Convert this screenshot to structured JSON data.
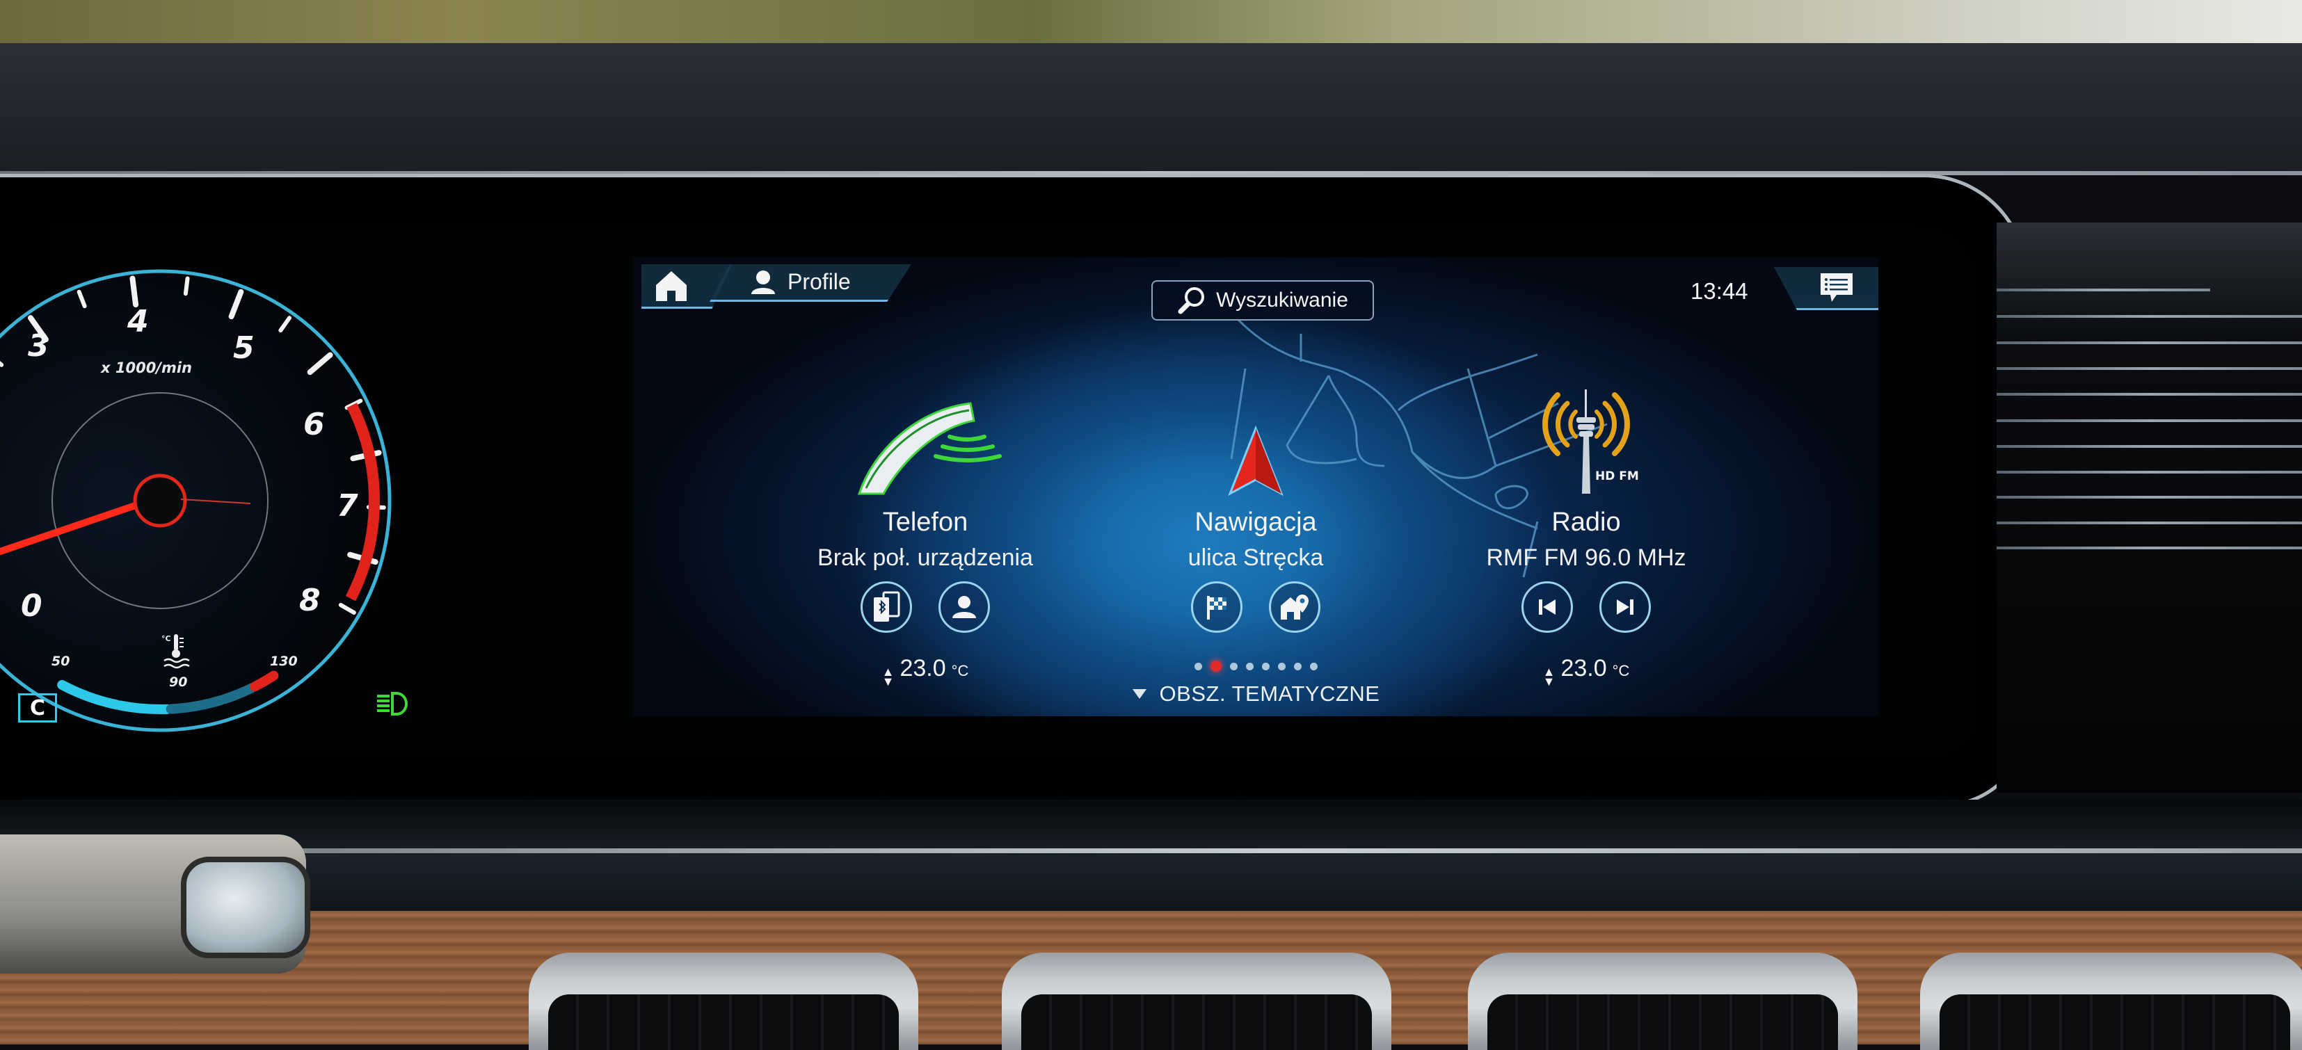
{
  "cluster": {
    "tachometer": {
      "unit_label": "x 1000/min",
      "tick_labels": [
        "0",
        "3",
        "4",
        "5",
        "6",
        "7",
        "8"
      ],
      "needle_rpm_x1000": 0.8,
      "redline_from_x1000": 6.5
    },
    "coolant_gauge": {
      "icon": "coolant-temperature-icon",
      "labels": [
        "50",
        "90",
        "130"
      ],
      "unit": "°C"
    },
    "gear_indicator": "C",
    "indicator_icons": [
      "low-beam-headlight-icon"
    ],
    "colors": {
      "accent": "#38c6ea",
      "redline": "#e0241c",
      "needle": "#ff2a1a",
      "headlight": "#3fd63a"
    }
  },
  "head_unit": {
    "topbar": {
      "home_icon": "home-icon",
      "profile_icon": "user-icon",
      "profile_label": "Profile",
      "search_icon": "search-icon",
      "search_label": "Wyszukiwanie",
      "clock": "13:44",
      "messages_icon": "message-list-icon"
    },
    "tiles": [
      {
        "id": "phone",
        "icon": "phone-handset-icon",
        "title": "Telefon",
        "subtitle": "Brak poł. urządzenia",
        "actions": [
          {
            "icon": "bluetooth-devices-icon",
            "label": "Connect device"
          },
          {
            "icon": "contacts-icon",
            "label": "Contacts"
          }
        ],
        "temperature": "23.0",
        "temperature_unit": "°C"
      },
      {
        "id": "navigation",
        "icon": "navigation-arrow-icon",
        "title": "Nawigacja",
        "subtitle": "ulica Stręcka",
        "actions": [
          {
            "icon": "checkered-flag-icon",
            "label": "Destination"
          },
          {
            "icon": "home-pin-icon",
            "label": "Home"
          }
        ]
      },
      {
        "id": "radio",
        "icon": "radio-tower-icon",
        "badge": "HD FM",
        "title": "Radio",
        "subtitle": "RMF FM 96.0 MHz",
        "actions": [
          {
            "icon": "skip-previous-icon",
            "label": "Previous station"
          },
          {
            "icon": "skip-next-icon",
            "label": "Next station"
          }
        ],
        "temperature": "23.0",
        "temperature_unit": "°C"
      }
    ],
    "pager": {
      "total": 8,
      "active_index": 1
    },
    "topics": {
      "icon": "triangle-down-icon",
      "label": "OBSZ. TEMATYCZNE"
    },
    "colors": {
      "accent_line": "#6fb8e6",
      "active_dot": "#e12b2b",
      "button_ring": "#9bd2ec"
    }
  }
}
